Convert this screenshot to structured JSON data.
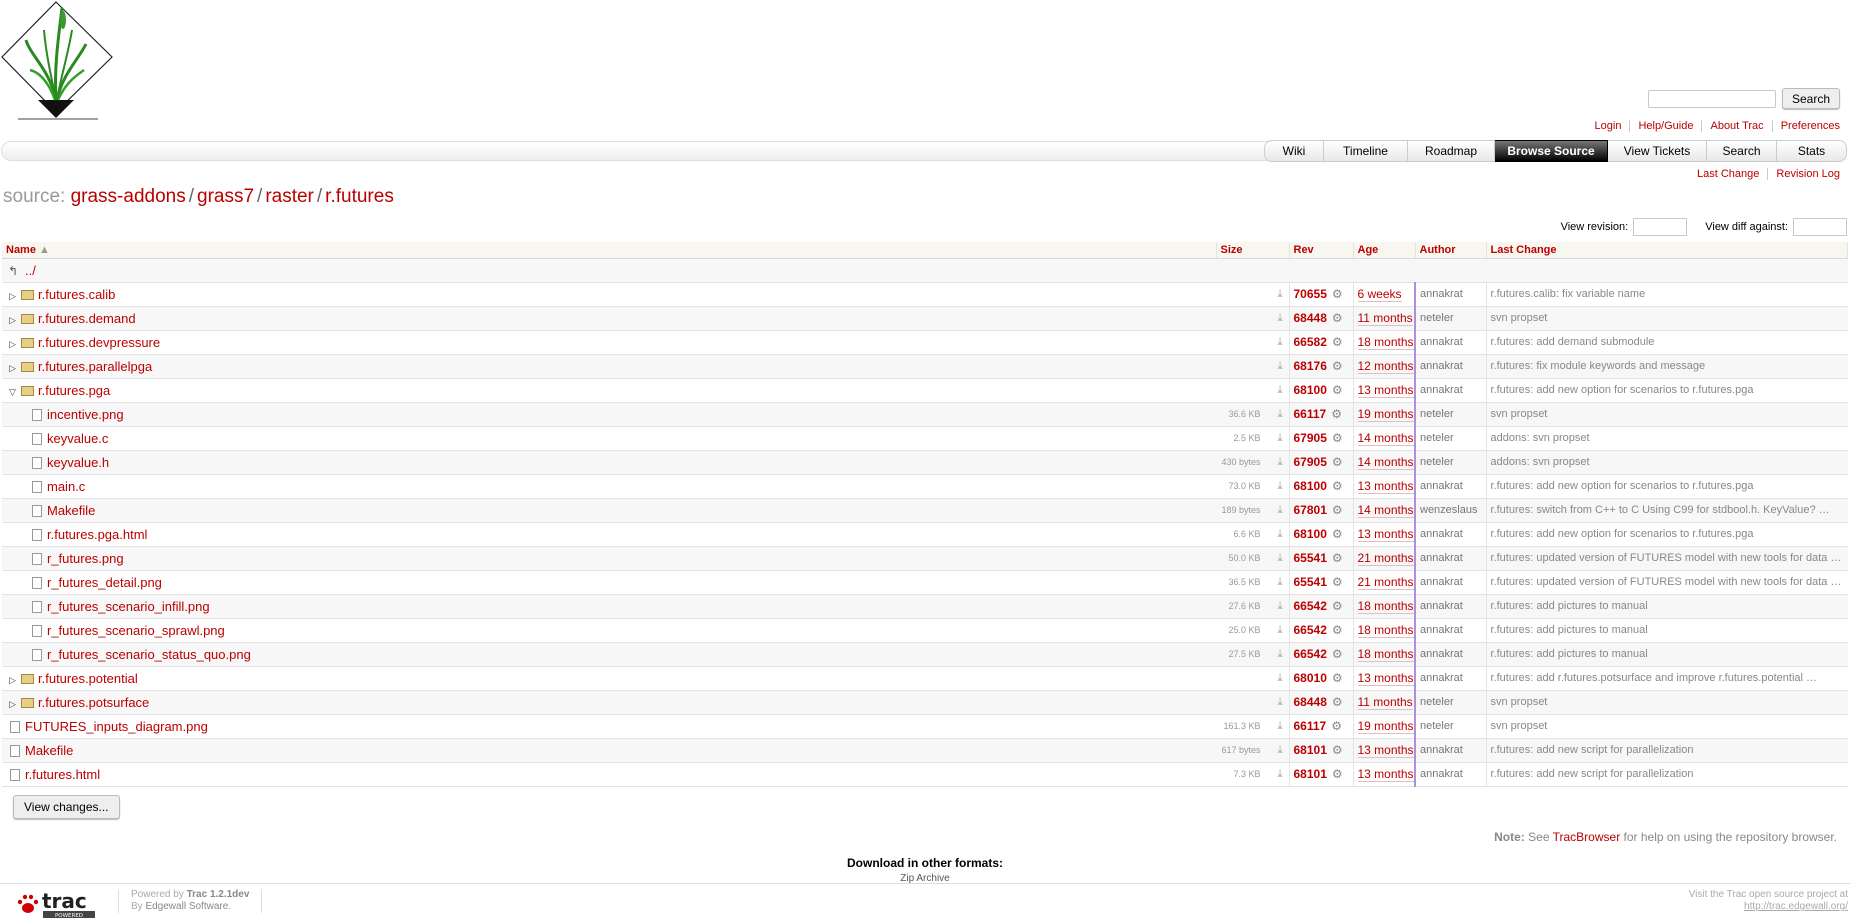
{
  "header": {
    "search_button": "Search",
    "search_placeholder": ""
  },
  "metanav": [
    "Login",
    "Help/Guide",
    "About Trac",
    "Preferences"
  ],
  "mainnav": [
    {
      "label": "Wiki",
      "w": 60
    },
    {
      "label": "Timeline",
      "w": 84
    },
    {
      "label": "Roadmap",
      "w": 87
    },
    {
      "label": "Browse Source",
      "w": 113,
      "active": true
    },
    {
      "label": "View Tickets",
      "w": 99
    },
    {
      "label": "Search",
      "w": 70
    },
    {
      "label": "Stats",
      "w": 70
    }
  ],
  "ctxtnav": [
    "Last Change",
    "Revision Log"
  ],
  "path": {
    "prefix": "source:",
    "segments": [
      "grass-addons",
      "grass7",
      "raster",
      "r.futures"
    ]
  },
  "revform": {
    "view_revision": "View revision:",
    "view_diff": "View diff against:"
  },
  "table": {
    "headers": {
      "name": "Name",
      "size": "Size",
      "rev": "Rev",
      "age": "Age",
      "author": "Author",
      "change": "Last Change"
    },
    "parent": "../",
    "rows": [
      {
        "kind": "dir",
        "expand": "collapsed",
        "indent": 0,
        "name": "r.futures.calib",
        "size": "",
        "rev": "70655",
        "age": "6 weeks",
        "author": "annakrat",
        "change": "r.futures.calib: fix variable name"
      },
      {
        "kind": "dir",
        "expand": "collapsed",
        "indent": 0,
        "name": "r.futures.demand",
        "size": "",
        "rev": "68448",
        "age": "11 months",
        "author": "neteler",
        "change": "svn propset"
      },
      {
        "kind": "dir",
        "expand": "collapsed",
        "indent": 0,
        "name": "r.futures.devpressure",
        "size": "",
        "rev": "66582",
        "age": "18 months",
        "author": "annakrat",
        "change": "r.futures: add demand submodule"
      },
      {
        "kind": "dir",
        "expand": "collapsed",
        "indent": 0,
        "name": "r.futures.parallelpga",
        "size": "",
        "rev": "68176",
        "age": "12 months",
        "author": "annakrat",
        "change": "r.futures: fix module keywords and message"
      },
      {
        "kind": "dir",
        "expand": "expanded",
        "indent": 0,
        "name": "r.futures.pga",
        "size": "",
        "rev": "68100",
        "age": "13 months",
        "author": "annakrat",
        "change": "r.futures: add new option for scenarios to r.futures.pga"
      },
      {
        "kind": "file",
        "indent": 1,
        "name": "incentive.png",
        "size": "36.6 KB",
        "rev": "66117",
        "age": "19 months",
        "author": "neteler",
        "change": "svn propset"
      },
      {
        "kind": "file",
        "indent": 1,
        "name": "keyvalue.c",
        "size": "2.5 KB",
        "rev": "67905",
        "age": "14 months",
        "author": "neteler",
        "change": "addons: svn propset"
      },
      {
        "kind": "file",
        "indent": 1,
        "name": "keyvalue.h",
        "size": "430 bytes",
        "rev": "67905",
        "age": "14 months",
        "author": "neteler",
        "change": "addons: svn propset"
      },
      {
        "kind": "file",
        "indent": 1,
        "name": "main.c",
        "size": "73.0 KB",
        "rev": "68100",
        "age": "13 months",
        "author": "annakrat",
        "change": "r.futures: add new option for scenarios to r.futures.pga"
      },
      {
        "kind": "file",
        "indent": 1,
        "name": "Makefile",
        "size": "189 bytes",
        "rev": "67801",
        "age": "14 months",
        "author": "wenzeslaus",
        "change": "r.futures: switch from C++ to C Using C99 for stdbool.h. KeyValue? …"
      },
      {
        "kind": "file",
        "indent": 1,
        "name": "r.futures.pga.html",
        "size": "6.6 KB",
        "rev": "68100",
        "age": "13 months",
        "author": "annakrat",
        "change": "r.futures: add new option for scenarios to r.futures.pga"
      },
      {
        "kind": "file",
        "indent": 1,
        "name": "r_futures.png",
        "size": "50.0 KB",
        "rev": "65541",
        "age": "21 months",
        "author": "annakrat",
        "change": "r.futures: updated version of FUTURES model with new tools for data …"
      },
      {
        "kind": "file",
        "indent": 1,
        "name": "r_futures_detail.png",
        "size": "36.5 KB",
        "rev": "65541",
        "age": "21 months",
        "author": "annakrat",
        "change": "r.futures: updated version of FUTURES model with new tools for data …"
      },
      {
        "kind": "file",
        "indent": 1,
        "name": "r_futures_scenario_infill.png",
        "size": "27.6 KB",
        "rev": "66542",
        "age": "18 months",
        "author": "annakrat",
        "change": "r.futures: add pictures to manual"
      },
      {
        "kind": "file",
        "indent": 1,
        "name": "r_futures_scenario_sprawl.png",
        "size": "25.0 KB",
        "rev": "66542",
        "age": "18 months",
        "author": "annakrat",
        "change": "r.futures: add pictures to manual"
      },
      {
        "kind": "file",
        "indent": 1,
        "name": "r_futures_scenario_status_quo.png",
        "size": "27.5 KB",
        "rev": "66542",
        "age": "18 months",
        "author": "annakrat",
        "change": "r.futures: add pictures to manual"
      },
      {
        "kind": "dir",
        "expand": "collapsed",
        "indent": 0,
        "name": "r.futures.potential",
        "size": "",
        "rev": "68010",
        "age": "13 months",
        "author": "annakrat",
        "change": "r.futures: add r.futures.potsurface and improve r.futures.potential …"
      },
      {
        "kind": "dir",
        "expand": "collapsed",
        "indent": 0,
        "name": "r.futures.potsurface",
        "size": "",
        "rev": "68448",
        "age": "11 months",
        "author": "neteler",
        "change": "svn propset"
      },
      {
        "kind": "file",
        "indent": 0,
        "name": "FUTURES_inputs_diagram.png",
        "size": "161.3 KB",
        "rev": "66117",
        "age": "19 months",
        "author": "neteler",
        "change": "svn propset"
      },
      {
        "kind": "file",
        "indent": 0,
        "name": "Makefile",
        "size": "617 bytes",
        "rev": "68101",
        "age": "13 months",
        "author": "annakrat",
        "change": "r.futures: add new script for parallelization"
      },
      {
        "kind": "file",
        "indent": 0,
        "name": "r.futures.html",
        "size": "7.3 KB",
        "rev": "68101",
        "age": "13 months",
        "author": "annakrat",
        "change": "r.futures: add new script for parallelization"
      }
    ]
  },
  "view_changes_button": "View changes...",
  "help": {
    "note": "Note:",
    "pre": "See",
    "link": "TracBrowser",
    "post": "for help on using the repository browser."
  },
  "download": {
    "heading": "Download in other formats:",
    "zip": "Zip Archive"
  },
  "footer": {
    "powered_pre": "Powered by",
    "trac_version": "Trac 1.2.1dev",
    "by_pre": "By",
    "company": "Edgewall Software",
    "visit": "Visit the Trac open source project at",
    "visit_url": "http://trac.edgewall.org/"
  },
  "icons": {
    "expand": "triangle-right-icon",
    "collapse": "triangle-down-icon",
    "download": "download-icon",
    "gear": "gear-icon",
    "folder": "folder-icon",
    "file": "file-icon",
    "parent": "parent-dir-icon"
  }
}
